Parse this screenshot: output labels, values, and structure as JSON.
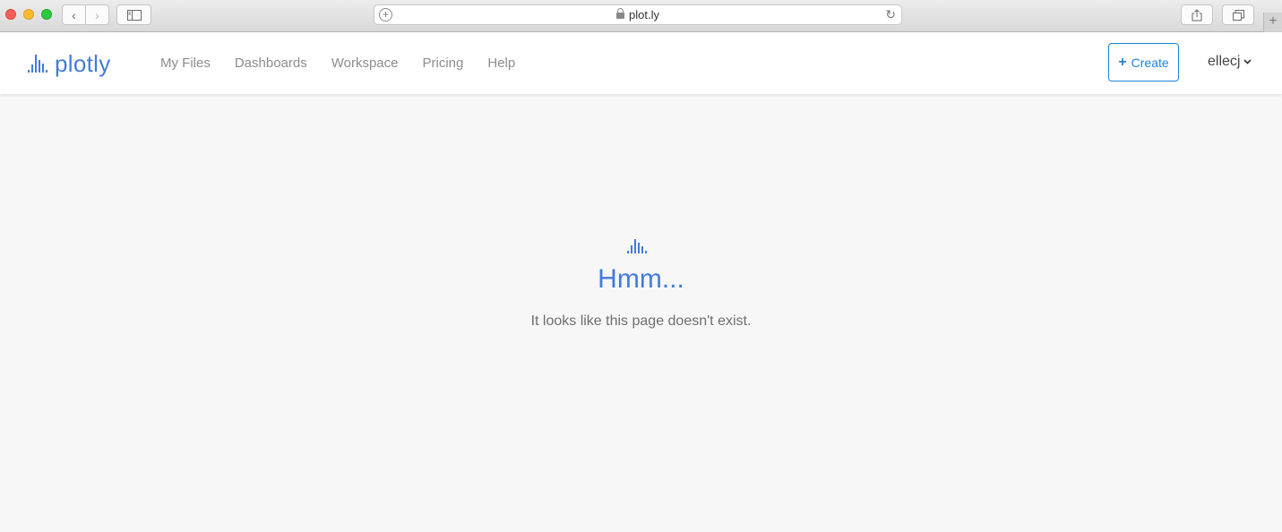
{
  "browser": {
    "url": "plot.ly",
    "back_glyph": "‹",
    "forward_glyph": "›",
    "new_tab_glyph": "+",
    "icons": [
      "sidebar-icon",
      "lock-icon",
      "reload-icon",
      "share-icon",
      "tabs-icon"
    ]
  },
  "header": {
    "logo_text": "plotly",
    "nav": [
      "My Files",
      "Dashboards",
      "Workspace",
      "Pricing",
      "Help"
    ],
    "create_label": "Create",
    "user_name": "ellecj",
    "accent_color": "#447adb",
    "button_color": "#1f83d6"
  },
  "error": {
    "title": "Hmm...",
    "message": "It looks like this page doesn't exist."
  }
}
